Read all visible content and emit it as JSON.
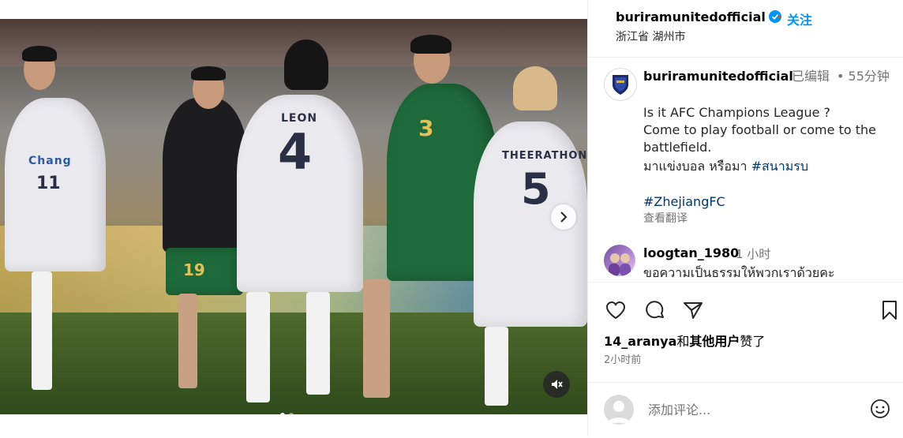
{
  "post": {
    "username": "buriramunitedofficial",
    "follow_label": "关注",
    "location": "浙江省 湖州市",
    "caption": {
      "username": "buriramunitedofficial",
      "edited_label": "已编辑",
      "time": "55分钟",
      "lines": [
        "Is it AFC Champions League ?",
        "Come to play football or come to the",
        "battlefield.",
        "มาแข่งบอล หรือมา",
        "#สนามรบ",
        "#ZhejiangFC"
      ],
      "translate_label": "查看翻译"
    },
    "comment": {
      "username": "loogtan_1980",
      "time": "1 小时",
      "text": "ขอความเป็นธรรมให้พวกเราด้วยคะ"
    },
    "likes": {
      "first_user": "14_aranya",
      "middle": "和",
      "others": "其他用户",
      "suffix": "赞了"
    },
    "posted_time": "2小时前",
    "comment_input_placeholder": "添加评论..."
  },
  "media": {
    "jersey_left_number": "11",
    "jersey_center_name": "LEON",
    "jersey_center_number": "4",
    "jersey_green_number": "3",
    "jersey_right_name": "THEERATHON",
    "jersey_right_number": "5",
    "jersey_sponsor": "Chang",
    "jersey_bg_number": "19",
    "carousel_index": 1,
    "carousel_count": 2
  },
  "icons": {
    "verified": "verified-badge-icon",
    "like": "heart-icon",
    "comment": "comment-icon",
    "share": "share-icon",
    "save": "bookmark-icon",
    "emoji": "emoji-icon",
    "mute": "mute-icon",
    "next": "chevron-right-icon"
  },
  "colors": {
    "accent": "#0095f6",
    "hashtag": "#00376b",
    "muted_text": "#737373"
  }
}
